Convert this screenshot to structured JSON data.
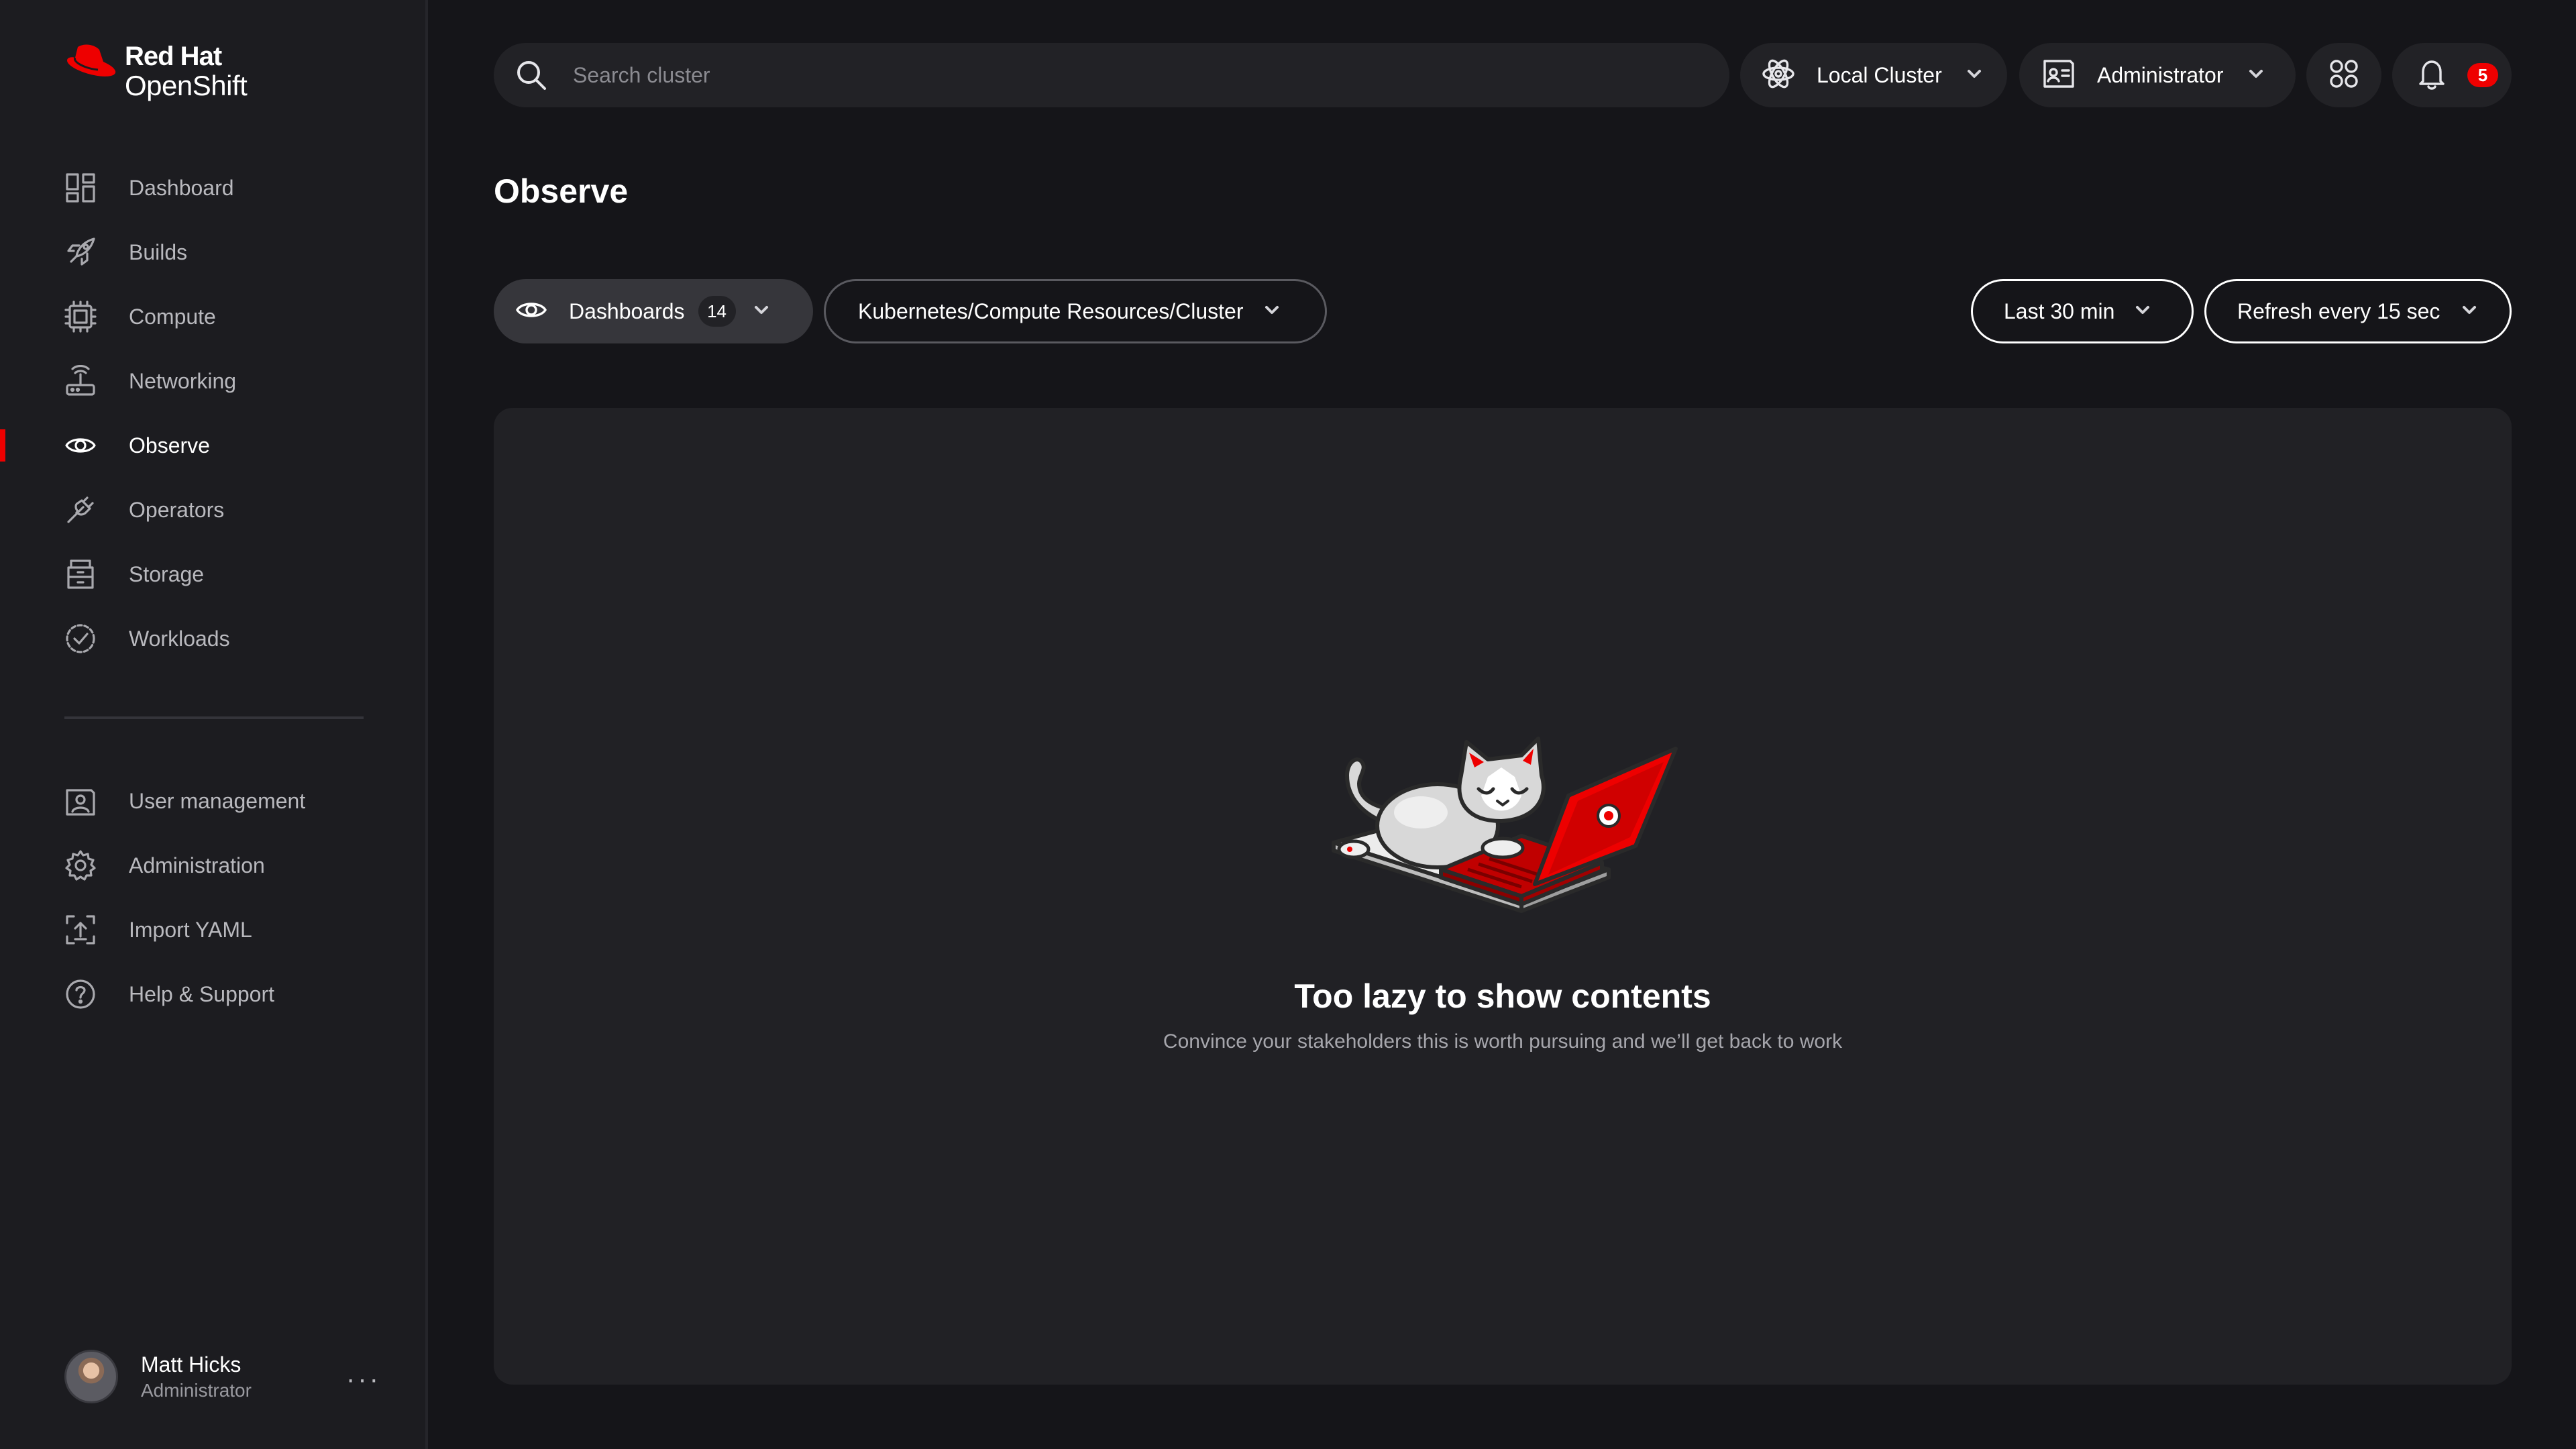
{
  "brand": {
    "line1": "Red Hat",
    "line2": "OpenShift",
    "accent": "#ee0000"
  },
  "sidebar": {
    "items": [
      {
        "label": "Dashboard",
        "icon": "dashboard-icon"
      },
      {
        "label": "Builds",
        "icon": "rocket-icon"
      },
      {
        "label": "Compute",
        "icon": "chip-icon"
      },
      {
        "label": "Networking",
        "icon": "router-icon"
      },
      {
        "label": "Observe",
        "icon": "eye-icon",
        "active": true
      },
      {
        "label": "Operators",
        "icon": "plug-icon"
      },
      {
        "label": "Storage",
        "icon": "storage-icon"
      },
      {
        "label": "Workloads",
        "icon": "check-circle-icon"
      }
    ],
    "secondary": [
      {
        "label": "User management",
        "icon": "user-card-icon"
      },
      {
        "label": "Administration",
        "icon": "gear-icon"
      },
      {
        "label": "Import YAML",
        "icon": "upload-icon"
      },
      {
        "label": "Help & Support",
        "icon": "help-icon"
      }
    ],
    "user": {
      "name": "Matt Hicks",
      "role": "Administrator",
      "more": "···"
    }
  },
  "header": {
    "search_placeholder": "Search cluster",
    "cluster": "Local Cluster",
    "role": "Administrator",
    "notifications": "5"
  },
  "page": {
    "title": "Observe",
    "dashboards_label": "Dashboards",
    "dashboards_count": "14",
    "dashboard_path": "Kubernetes/Compute Resources/Cluster",
    "time_range": "Last 30 min",
    "refresh": "Refresh every 15 sec"
  },
  "empty_state": {
    "title": "Too lazy to show contents",
    "subtitle": "Convince your stakeholders this is worth pursuing and we’ll get back to work"
  }
}
